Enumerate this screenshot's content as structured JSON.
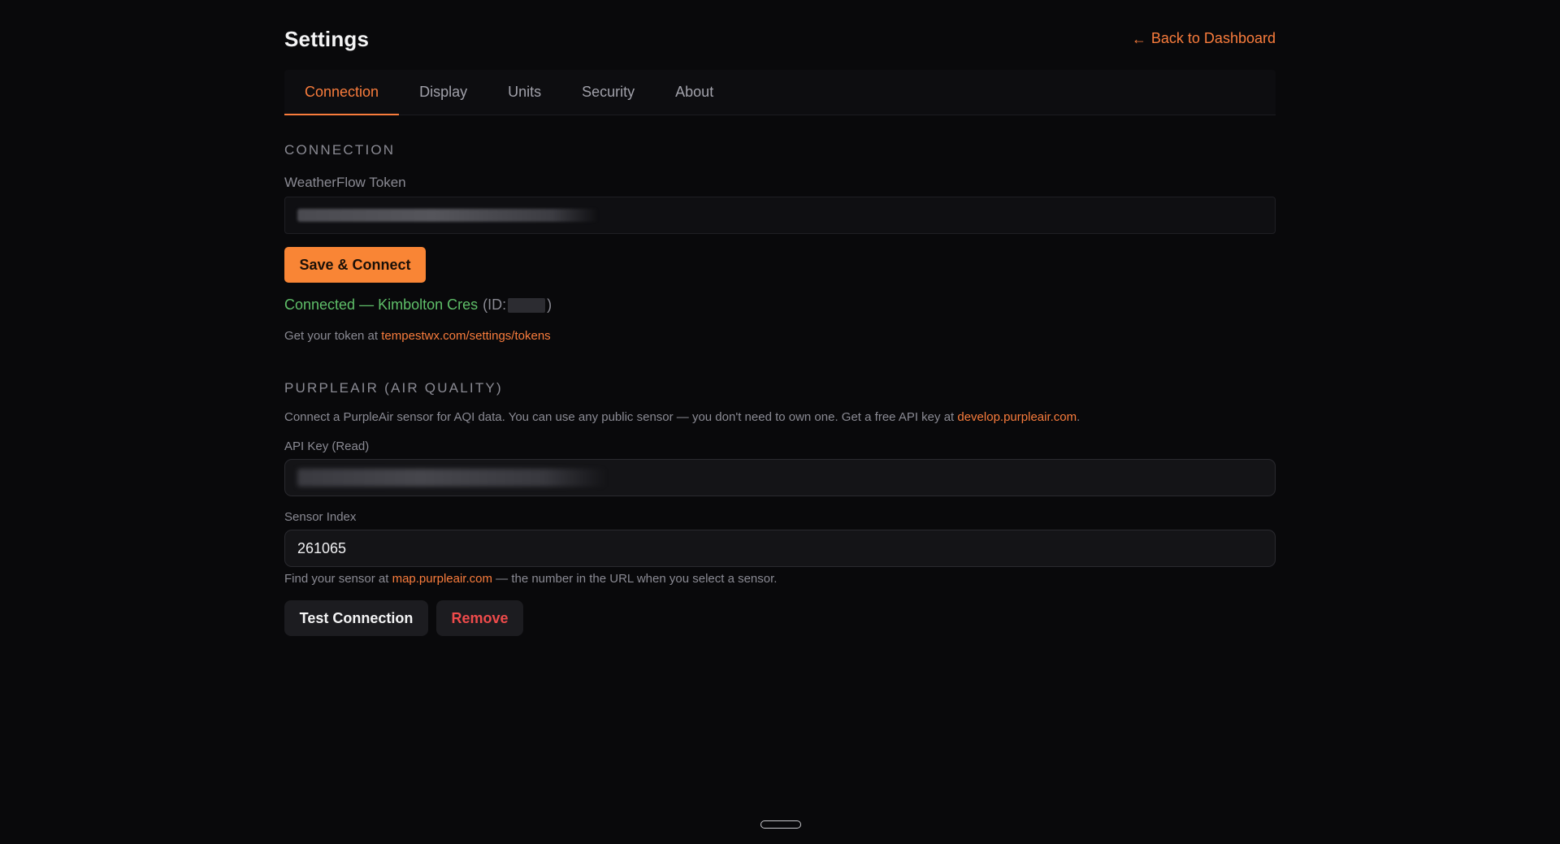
{
  "header": {
    "title": "Settings",
    "back_arrow": "←",
    "back_label": "Back to Dashboard"
  },
  "tabs": [
    {
      "label": "Connection",
      "active": true
    },
    {
      "label": "Display",
      "active": false
    },
    {
      "label": "Units",
      "active": false
    },
    {
      "label": "Security",
      "active": false
    },
    {
      "label": "About",
      "active": false
    }
  ],
  "connection": {
    "heading": "CONNECTION",
    "token_label": "WeatherFlow Token",
    "save_button": "Save & Connect",
    "status_connected": "Connected — Kimbolton Cres",
    "status_id_open": "(ID:",
    "status_id_close": ")",
    "help_prefix": "Get your token at",
    "help_link": "tempestwx.com/settings/tokens"
  },
  "purpleair": {
    "heading": "PURPLEAIR (AIR QUALITY)",
    "description_prefix": "Connect a PurpleAir sensor for AQI data. You can use any public sensor — you don't need to own one. Get a free API key at",
    "description_link": "develop.purpleair.com",
    "description_suffix": ".",
    "api_key_label": "API Key (Read)",
    "sensor_label": "Sensor Index",
    "sensor_value": "261065",
    "find_prefix": "Find your sensor at",
    "find_link": "map.purpleair.com",
    "find_suffix": "— the number in the URL when you select a sensor.",
    "test_button": "Test Connection",
    "remove_button": "Remove"
  },
  "colors": {
    "accent": "#f97c3c",
    "success": "#5fbf69",
    "danger": "#ef4b4b",
    "background": "#09090b"
  }
}
